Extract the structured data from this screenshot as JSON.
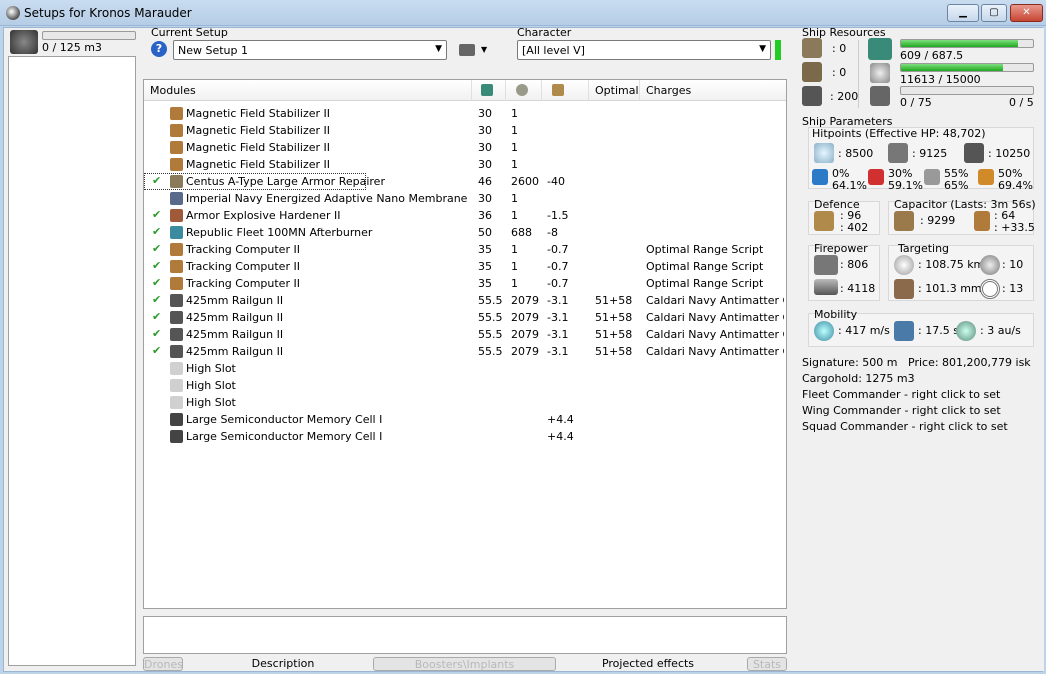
{
  "window": {
    "title": "Setups for Kronos Marauder"
  },
  "drones": {
    "capacity": "0 / 125 m3"
  },
  "setup": {
    "label": "Current Setup",
    "value": "New Setup 1"
  },
  "character": {
    "label": "Character",
    "value": "[All level V]"
  },
  "columns": {
    "modules": "Modules",
    "optimal": "Optimal",
    "charges": "Charges"
  },
  "modules": [
    {
      "name": "Magnetic Field Stabilizer II",
      "cpu": "30",
      "pg": "1",
      "cap": "",
      "optimal": "",
      "charges": "",
      "checked": false,
      "color": "#b07a3a"
    },
    {
      "name": "Magnetic Field Stabilizer II",
      "cpu": "30",
      "pg": "1",
      "cap": "",
      "optimal": "",
      "charges": "",
      "checked": false,
      "color": "#b07a3a"
    },
    {
      "name": "Magnetic Field Stabilizer II",
      "cpu": "30",
      "pg": "1",
      "cap": "",
      "optimal": "",
      "charges": "",
      "checked": false,
      "color": "#b07a3a"
    },
    {
      "name": "Magnetic Field Stabilizer II",
      "cpu": "30",
      "pg": "1",
      "cap": "",
      "optimal": "",
      "charges": "",
      "checked": false,
      "color": "#b07a3a"
    },
    {
      "name": "Centus A-Type Large Armor Repairer",
      "cpu": "46",
      "pg": "2600",
      "cap": "-40",
      "optimal": "",
      "charges": "",
      "checked": true,
      "color": "#8a7a5a"
    },
    {
      "name": "Imperial Navy Energized Adaptive Nano Membrane",
      "cpu": "30",
      "pg": "1",
      "cap": "",
      "optimal": "",
      "charges": "",
      "checked": false,
      "color": "#5a6a8a"
    },
    {
      "name": "Armor Explosive Hardener II",
      "cpu": "36",
      "pg": "1",
      "cap": "-1.5",
      "optimal": "",
      "charges": "",
      "checked": true,
      "color": "#a05a3a"
    },
    {
      "name": "Republic Fleet 100MN Afterburner",
      "cpu": "50",
      "pg": "688",
      "cap": "-8",
      "optimal": "",
      "charges": "",
      "checked": true,
      "color": "#3a8aa0"
    },
    {
      "name": "Tracking Computer II",
      "cpu": "35",
      "pg": "1",
      "cap": "-0.7",
      "optimal": "",
      "charges": "Optimal Range Script",
      "checked": true,
      "color": "#b07a3a"
    },
    {
      "name": "Tracking Computer II",
      "cpu": "35",
      "pg": "1",
      "cap": "-0.7",
      "optimal": "",
      "charges": "Optimal Range Script",
      "checked": true,
      "color": "#b07a3a"
    },
    {
      "name": "Tracking Computer II",
      "cpu": "35",
      "pg": "1",
      "cap": "-0.7",
      "optimal": "",
      "charges": "Optimal Range Script",
      "checked": true,
      "color": "#b07a3a"
    },
    {
      "name": "425mm Railgun II",
      "cpu": "55.5",
      "pg": "2079",
      "cap": "-3.1",
      "optimal": "51+58",
      "charges": "Caldari Navy Antimatter Ch...",
      "checked": true,
      "color": "#555"
    },
    {
      "name": "425mm Railgun II",
      "cpu": "55.5",
      "pg": "2079",
      "cap": "-3.1",
      "optimal": "51+58",
      "charges": "Caldari Navy Antimatter Ch...",
      "checked": true,
      "color": "#555"
    },
    {
      "name": "425mm Railgun II",
      "cpu": "55.5",
      "pg": "2079",
      "cap": "-3.1",
      "optimal": "51+58",
      "charges": "Caldari Navy Antimatter Ch...",
      "checked": true,
      "color": "#555"
    },
    {
      "name": "425mm Railgun II",
      "cpu": "55.5",
      "pg": "2079",
      "cap": "-3.1",
      "optimal": "51+58",
      "charges": "Caldari Navy Antimatter Ch...",
      "checked": true,
      "color": "#555"
    },
    {
      "name": "High Slot",
      "cpu": "",
      "pg": "",
      "cap": "",
      "optimal": "",
      "charges": "",
      "checked": false,
      "color": "#d0d0d0"
    },
    {
      "name": "High Slot",
      "cpu": "",
      "pg": "",
      "cap": "",
      "optimal": "",
      "charges": "",
      "checked": false,
      "color": "#d0d0d0"
    },
    {
      "name": "High Slot",
      "cpu": "",
      "pg": "",
      "cap": "",
      "optimal": "",
      "charges": "",
      "checked": false,
      "color": "#d0d0d0"
    },
    {
      "name": "Large Semiconductor Memory Cell I",
      "cpu": "",
      "pg": "",
      "cap": "+4.4",
      "optimal": "",
      "charges": "",
      "checked": false,
      "color": "#444"
    },
    {
      "name": "Large Semiconductor Memory Cell I",
      "cpu": "",
      "pg": "",
      "cap": "+4.4",
      "optimal": "",
      "charges": "",
      "checked": false,
      "color": "#444"
    }
  ],
  "tabs": {
    "drones": "Drones",
    "description": "Description",
    "boosters": "Boosters\\Implants",
    "projected": "Projected effects",
    "stats": "Stats"
  },
  "resources": {
    "title": "Ship Resources",
    "turret": ": 0",
    "launcher": ": 0",
    "bandwidth": ": 200",
    "cpu": "609 / 687.5",
    "cpu_fill": 0.886,
    "powergrid": "11613 / 15000",
    "powergrid_fill": 0.774,
    "calibration": "0 / 75",
    "calibration_fill": 0,
    "rigs": "0 / 5"
  },
  "params": {
    "title": "Ship Parameters",
    "hitpoints": "Hitpoints (Effective HP: 48,702)",
    "shield_hp": ": 8500",
    "armor_hp": ": 9125",
    "structure_hp": ": 10250",
    "em": [
      "0%",
      "64.1%"
    ],
    "thermal": [
      "30%",
      "59.1%"
    ],
    "kinetic": [
      "55%",
      "65%"
    ],
    "explosive": [
      "50%",
      "69.4%"
    ],
    "defence_title": "Defence",
    "defence_1": ": 96",
    "defence_2": ": 402",
    "capacitor_title": "Capacitor (Lasts: 3m 56s)",
    "capacitor_amount": ": 9299",
    "capacitor_1": ": 64",
    "capacitor_2": ": +33.5",
    "firepower_title": "Firepower",
    "dps": ": 806",
    "volley": ": 4118",
    "targeting_title": "Targeting",
    "range": ": 108.75 km",
    "targets": ": 10",
    "scan": ": 101.3 mm",
    "sensor": ": 13",
    "mobility_title": "Mobility",
    "velocity": ": 417 m/s",
    "align": ": 17.5 s",
    "warp": ": 3 au/s",
    "signature": "Signature: 500 m",
    "price": "Price: 801,200,779 isk",
    "cargohold": "Cargohold: 1275 m3",
    "fleet": "Fleet Commander - right click to set",
    "wing": "Wing Commander - right click to set",
    "squad": "Squad Commander - right click to set"
  }
}
